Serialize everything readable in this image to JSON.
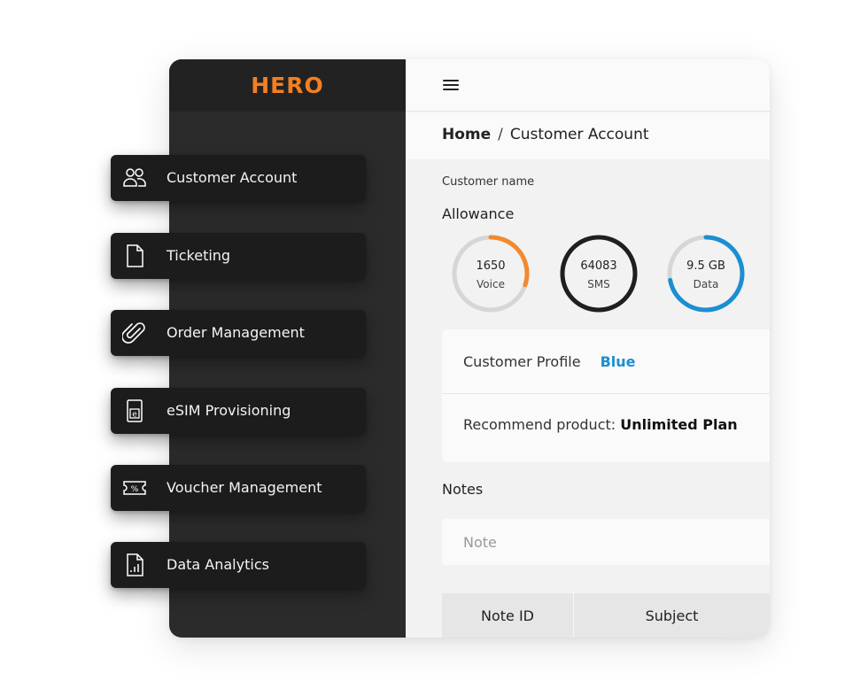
{
  "app": {
    "logo": "HERO",
    "brand_color": "#f27f22"
  },
  "breadcrumb": {
    "home": "Home",
    "separator": "/",
    "current": "Customer Account"
  },
  "customer": {
    "name_label": "Customer name",
    "allowance_title": "Allowance"
  },
  "allowance": [
    {
      "value": "1650",
      "label": "Voice",
      "fraction": 0.3,
      "color": "#f28a2e"
    },
    {
      "value": "64083",
      "label": "SMS",
      "fraction": 1.0,
      "color": "#1f1f1f"
    },
    {
      "value": "9.5 GB",
      "label": "Data",
      "fraction": 0.72,
      "color": "#1a8fd1"
    }
  ],
  "profile": {
    "label": "Customer Profile",
    "value": "Blue",
    "recommend_label": "Recommend product:",
    "recommend_value": "Unlimited Plan"
  },
  "notes": {
    "title": "Notes",
    "placeholder": "Note"
  },
  "table": {
    "columns": [
      "Note ID",
      "Subject"
    ]
  },
  "nav": [
    {
      "label": "Customer Account",
      "icon": "users-icon"
    },
    {
      "label": "Ticketing",
      "icon": "document-icon"
    },
    {
      "label": "Order Management",
      "icon": "paperclip-icon"
    },
    {
      "label": "eSIM Provisioning",
      "icon": "esim-icon"
    },
    {
      "label": "Voucher Management",
      "icon": "voucher-icon"
    },
    {
      "label": "Data Analytics",
      "icon": "analytics-icon"
    }
  ]
}
